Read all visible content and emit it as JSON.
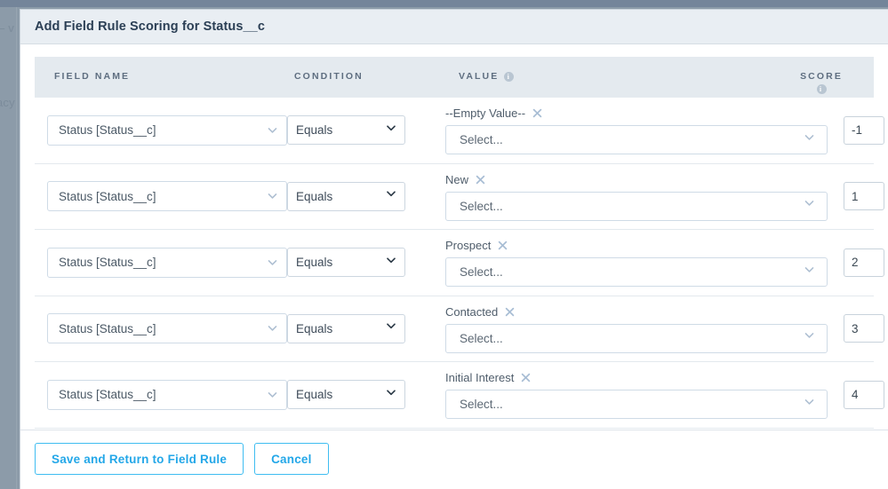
{
  "backdrop": {
    "ghost_text_1": "– v",
    "ghost_text_2": "acy"
  },
  "modal": {
    "title": "Add Field Rule Scoring for Status__c",
    "table": {
      "headers": {
        "field_name": "FIELD NAME",
        "condition": "CONDITION",
        "value": "VALUE",
        "score": "SCORE",
        "value_info_icon": "info-icon",
        "score_info_icon": "info-icon"
      },
      "select_placeholder": "Select...",
      "rows": [
        {
          "field_name": "Status [Status__c]",
          "condition": "Equals",
          "value_chip": "--Empty Value--",
          "value_placeholder": "Select...",
          "score": "-1",
          "delete_icon": "trash-icon"
        },
        {
          "field_name": "Status [Status__c]",
          "condition": "Equals",
          "value_chip": "New",
          "value_placeholder": "Select...",
          "score": "1",
          "delete_icon": "trash-icon"
        },
        {
          "field_name": "Status [Status__c]",
          "condition": "Equals",
          "value_chip": "Prospect",
          "value_placeholder": "Select...",
          "score": "2",
          "delete_icon": "trash-icon"
        },
        {
          "field_name": "Status [Status__c]",
          "condition": "Equals",
          "value_chip": "Contacted",
          "value_placeholder": "Select...",
          "score": "3",
          "delete_icon": "trash-icon"
        },
        {
          "field_name": "Status [Status__c]",
          "condition": "Equals",
          "value_chip": "Initial Interest",
          "value_placeholder": "Select...",
          "score": "4",
          "delete_icon": "trash-icon"
        }
      ],
      "condition_options": [
        "Equals"
      ]
    },
    "footer": {
      "save_label": "Save and Return to Field Rule",
      "cancel_label": "Cancel"
    }
  },
  "colors": {
    "accent": "#23a7e8",
    "trash": "#26b3e8",
    "header_bg": "#e9eef3",
    "table_header_bg": "#e4eaef",
    "title_text": "#2b3f55",
    "backdrop": "#8c9ba9"
  }
}
